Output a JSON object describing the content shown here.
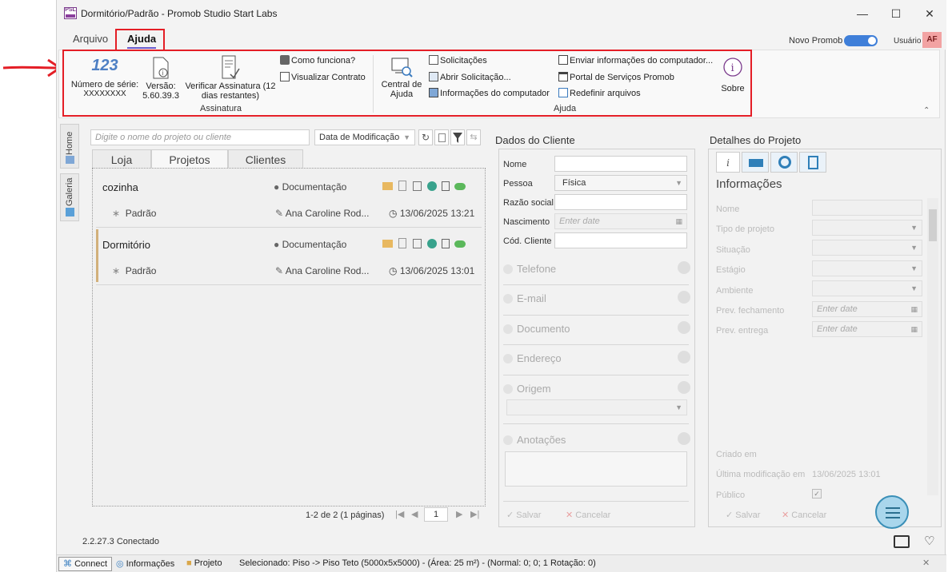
{
  "window": {
    "title": "Dormitório/Padrão - Promob Studio Start Labs",
    "logo_text": "PSL"
  },
  "menu": {
    "tabs": [
      "Arquivo",
      "Ajuda"
    ],
    "novo_promob": "Novo Promob",
    "usuario": "Usuário",
    "avatar": "AF"
  },
  "ribbon": {
    "numero_serie_label": "Número de série:",
    "numero_serie_value": "XXXXXXXX",
    "versao_label": "Versão:",
    "versao_value": "5.60.39.3",
    "verificar_label": "Verificar Assinatura (12",
    "verificar_label2": "dias restantes)",
    "como_funciona": "Como funciona?",
    "visualizar_contrato": "Visualizar Contrato",
    "group_assinatura": "Assinatura",
    "central_ajuda_1": "Central de",
    "central_ajuda_2": "Ajuda",
    "solicitacoes": "Solicitações",
    "abrir_solicitacao": "Abrir Solicitação...",
    "info_computador": "Informações do computador",
    "enviar_info": "Enviar informações do computador...",
    "portal_servicos": "Portal de Serviços Promob",
    "redefinir_arquivos": "Redefinir arquivos",
    "sobre": "Sobre",
    "group_ajuda": "Ajuda"
  },
  "side_tabs": {
    "home": "Home",
    "galeria": "Galeria"
  },
  "projects": {
    "search_placeholder": "Digite o nome do projeto ou cliente",
    "sort": "Data de Modificação",
    "tabs": [
      "Loja",
      "Projetos",
      "Clientes"
    ],
    "items": [
      {
        "name": "cozinha",
        "doc": "Documentação",
        "sub": "Padrão",
        "user": "Ana Caroline Rod...",
        "date": "13/06/2025 13:21"
      },
      {
        "name": "Dormitório",
        "doc": "Documentação",
        "sub": "Padrão",
        "user": "Ana Caroline Rod...",
        "date": "13/06/2025 13:01"
      }
    ],
    "pagination": "1-2 de 2 (1 páginas)",
    "page": "1"
  },
  "client": {
    "title": "Dados do Cliente",
    "nome": "Nome",
    "pessoa": "Pessoa",
    "pessoa_value": "Física",
    "razao_social": "Razão social",
    "nascimento": "Nascimento",
    "nascimento_placeholder": "Enter date",
    "cod_cliente": "Cód. Cliente",
    "telefone": "Telefone",
    "email": "E-mail",
    "documento": "Documento",
    "endereco": "Endereço",
    "origem": "Origem",
    "anotacoes": "Anotações",
    "salvar": "Salvar",
    "cancelar": "Cancelar"
  },
  "details": {
    "title": "Detalhes do Projeto",
    "informacoes": "Informações",
    "nome": "Nome",
    "tipo_projeto": "Tipo de projeto",
    "situacao": "Situação",
    "estagio": "Estágio",
    "ambiente": "Ambiente",
    "prev_fechamento": "Prev. fechamento",
    "prev_entrega": "Prev. entrega",
    "enter_date": "Enter date",
    "criado_em": "Criado em",
    "ultima_mod": "Última modificação em",
    "ultima_mod_value": "13/06/2025 13:01",
    "publico": "Público",
    "salvar": "Salvar",
    "cancelar": "Cancelar"
  },
  "footer": {
    "version": "2.2.27.3 Conectado",
    "connect": "Connect",
    "informacoes": "Informações",
    "projeto": "Projeto",
    "selecionado": "Selecionado: Piso -> Piso Teto (5000x5x5000) - (Área: 25 m²) - (Normal: 0; 0; 1 Rotação: 0)"
  }
}
